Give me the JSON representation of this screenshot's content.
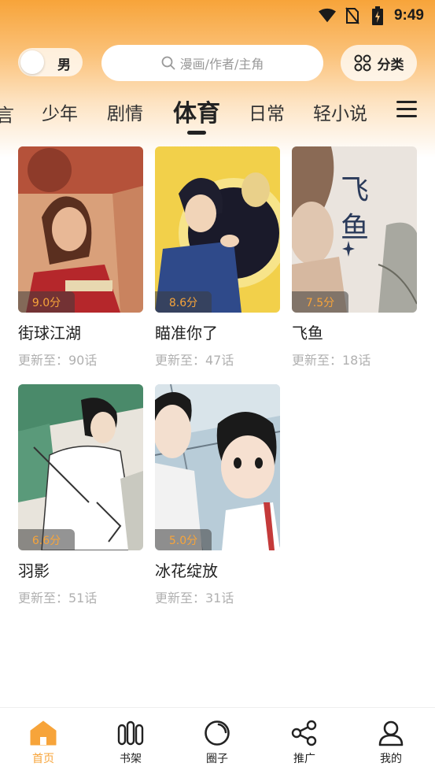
{
  "status_bar": {
    "time": "9:49",
    "icons": [
      "wifi-icon",
      "no-sim-icon",
      "battery-charging-icon"
    ]
  },
  "header": {
    "gender_toggle_label": "男",
    "search_placeholder": "漫画/作者/主角",
    "category_label": "分类"
  },
  "tabs": [
    {
      "label": "少年",
      "active": false
    },
    {
      "label": "剧情",
      "active": false
    },
    {
      "label": "体育",
      "active": true
    },
    {
      "label": "日常",
      "active": false
    },
    {
      "label": "轻小说",
      "active": false
    }
  ],
  "comics": [
    {
      "title": "街球江湖",
      "score": "9.0分",
      "update": "更新至：90话"
    },
    {
      "title": "瞄准你了",
      "score": "8.6分",
      "update": "更新至：47话"
    },
    {
      "title": "飞鱼",
      "score": "7.5分",
      "update": "更新至：18话",
      "cover_text": "飞鱼"
    },
    {
      "title": "羽影",
      "score": "6.6分",
      "update": "更新至：51话"
    },
    {
      "title": "冰花绽放",
      "score": "5.0分",
      "update": "更新至：31话"
    }
  ],
  "bottom_nav": [
    {
      "label": "首页",
      "icon": "home-icon",
      "active": true
    },
    {
      "label": "书架",
      "icon": "bookshelf-icon",
      "active": false
    },
    {
      "label": "圈子",
      "icon": "circle-icon",
      "active": false
    },
    {
      "label": "推广",
      "icon": "share-icon",
      "active": false
    },
    {
      "label": "我的",
      "icon": "profile-icon",
      "active": false
    }
  ],
  "colors": {
    "accent": "#f7a43a",
    "score": "#f7a43a"
  }
}
